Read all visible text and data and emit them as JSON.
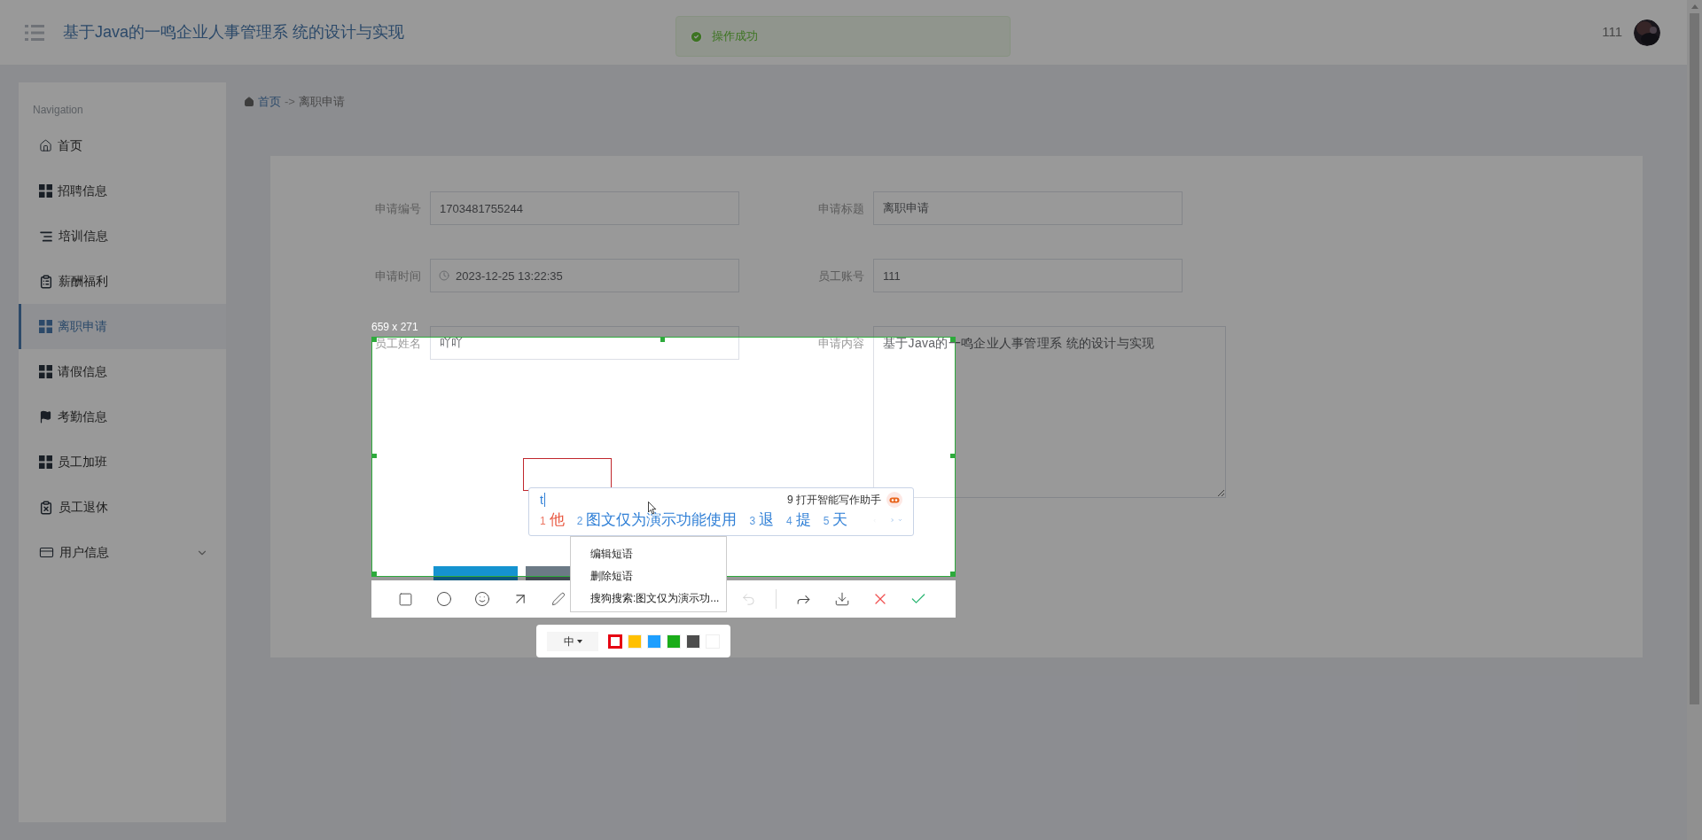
{
  "header": {
    "title": "基于Java的一鸣企业人事管理系 统的设计与实现",
    "username": "111"
  },
  "toast": {
    "message": "操作成功",
    "kind": "success"
  },
  "sidebar": {
    "heading": "Navigation",
    "items": [
      {
        "label": "首页",
        "selected": false,
        "has_submenu": false
      },
      {
        "label": "招聘信息",
        "selected": false,
        "has_submenu": false
      },
      {
        "label": "培训信息",
        "selected": false,
        "has_submenu": false
      },
      {
        "label": "薪酬福利",
        "selected": false,
        "has_submenu": false
      },
      {
        "label": "离职申请",
        "selected": true,
        "has_submenu": false
      },
      {
        "label": "请假信息",
        "selected": false,
        "has_submenu": false
      },
      {
        "label": "考勤信息",
        "selected": false,
        "has_submenu": false
      },
      {
        "label": "员工加班",
        "selected": false,
        "has_submenu": false
      },
      {
        "label": "员工退休",
        "selected": false,
        "has_submenu": false
      },
      {
        "label": "用户信息",
        "selected": false,
        "has_submenu": true
      }
    ]
  },
  "breadcrumb": {
    "home": "首页",
    "separator": "->",
    "current": "离职申请"
  },
  "form": {
    "fields": [
      {
        "label": "申请编号",
        "value": "1703481755244",
        "kind": "text"
      },
      {
        "label": "申请标题",
        "value": "离职申请",
        "kind": "text"
      },
      {
        "label": "申请时间",
        "value": "2023-12-25 13:22:35",
        "kind": "date"
      },
      {
        "label": "员工账号",
        "value": "111",
        "kind": "text"
      },
      {
        "label": "员工姓名",
        "value": "吖吖",
        "kind": "text"
      },
      {
        "label": "申请内容",
        "value": "基于Java的一鸣企业人事管理系 统的设计与实现",
        "kind": "textarea"
      }
    ],
    "buttons": [
      {
        "kind": "primary"
      },
      {
        "kind": "secondary"
      }
    ]
  },
  "capture": {
    "size_label": "659 x 271",
    "undo_disabled": true,
    "pen_size": "中",
    "colors": [
      {
        "color": "#e60012",
        "selected": true
      },
      {
        "color": "#ffc000",
        "selected": false
      },
      {
        "color": "#1e9fff",
        "selected": false
      },
      {
        "color": "#1aad19",
        "selected": false
      },
      {
        "color": "#4d4d4d",
        "selected": false
      },
      {
        "color": "#ffffff",
        "selected": false
      }
    ]
  },
  "ime": {
    "input": "t",
    "assistant": "9 打开智能写作助手",
    "candidates": [
      {
        "index": "1",
        "text": "他",
        "selected": true
      },
      {
        "index": "2",
        "text": "图文仅为演示功能使用",
        "selected": false
      },
      {
        "index": "3",
        "text": "退",
        "selected": false
      },
      {
        "index": "4",
        "text": "提",
        "selected": false
      },
      {
        "index": "5",
        "text": "天",
        "selected": false
      }
    ]
  },
  "context_menu": {
    "items": [
      "编辑短语",
      "删除短语",
      "搜狗搜索:图文仅为演示功..."
    ]
  }
}
